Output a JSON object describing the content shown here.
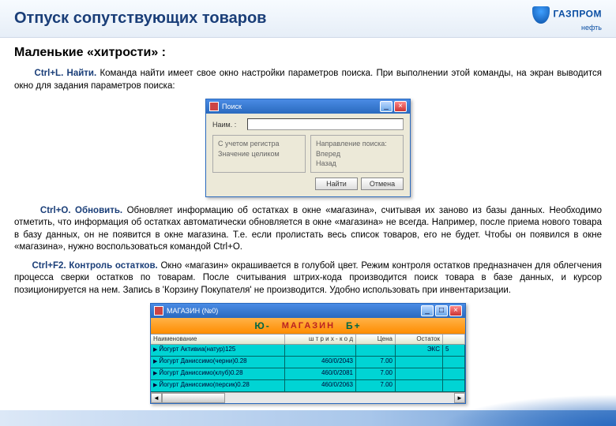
{
  "header": {
    "title": "Отпуск сопутствующих товаров"
  },
  "logo": {
    "line1": "ГАЗПРОМ",
    "line2": "нефть"
  },
  "subtitle": "Маленькие «хитрости» :",
  "p1": {
    "cmd": "Ctrl+L. Найти.",
    "text": " Команда найти имеет свое окно настройки параметров поиска. При выполнении этой команды, на экран выводится окно для задания параметров поиска:"
  },
  "dlg": {
    "title": "Поиск",
    "field_label": "Наим. :",
    "opts_left": [
      "С учетом регистра",
      "Значение целиком"
    ],
    "opts_right": [
      "Направление поиска:",
      "Вперед",
      "Назад"
    ],
    "btn_ok": "Найти",
    "btn_cancel": "Отмена"
  },
  "p2": {
    "cmd": "Ctrl+O. Обновить.",
    "text": " Обновляет информацию об остатках в окне «магазина», считывая их заново из базы данных. Необходимо отметить, что информация об остатках автоматически обновляется в окне «магазина» не всегда. Например, после приема нового товара в базу данных, он не появится в окне магазина. Т.е. если пролистать весь список товаров, его не будет. Чтобы он появился в окне «магазина», нужно воспользоваться командой Ctrl+O."
  },
  "p3": {
    "cmd": "Ctrl+F2. Контроль остатков.",
    "text": " Окно «магазин» окрашивается в голубой цвет. Режим контроля остатков предназначен для облегчения процесса сверки остатков по товарам. После считывания штрих-кода производится поиск товара в базе данных, и курсор позиционируется на нем. Запись в 'Корзину Покупателя' не производится. Удобно использовать при инвентаризации."
  },
  "store": {
    "title": "МАГАЗИН (№0)",
    "banner": "МАГАЗИН",
    "nav_prev": "Ю-",
    "nav_next": "Б+",
    "cols": [
      "Наименование",
      "ш т р и х - к о д",
      "Цена",
      "Остаток",
      ""
    ],
    "rows": [
      {
        "n": "Йогурт Активиа(натур)125",
        "b": "",
        "p": "",
        "o": "ЭКС",
        "s": "5"
      },
      {
        "n": "Йогурт Даниссимо(черни)0.28",
        "b": "460/0/2043",
        "p": "7.00",
        "o": "",
        "s": ""
      },
      {
        "n": "Йогурт Даниссимо(клуб)0.28",
        "b": "460/0/2081",
        "p": "7.00",
        "o": "",
        "s": ""
      },
      {
        "n": "Йогурт Даниссимо(персик)0.28",
        "b": "460/0/2063",
        "p": "7.00",
        "o": "",
        "s": ""
      }
    ]
  }
}
